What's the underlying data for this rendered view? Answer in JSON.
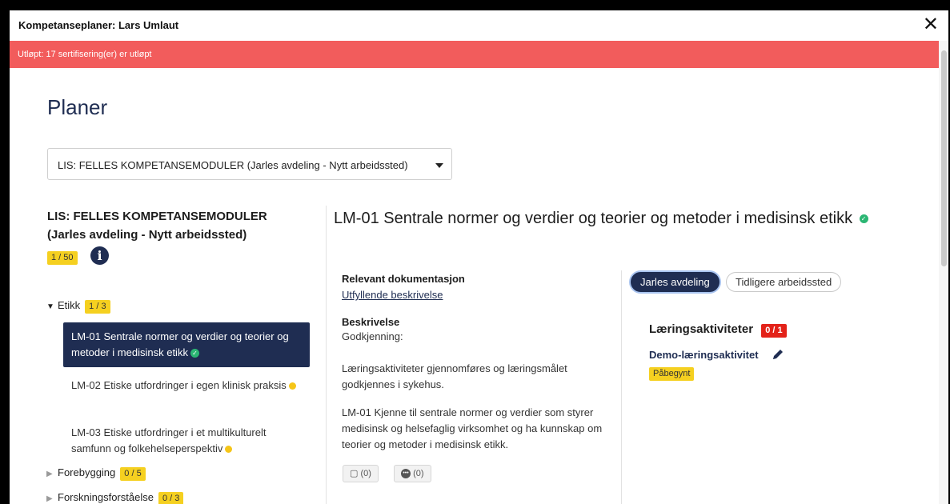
{
  "window": {
    "title": "Kompetanseplaner: Lars Umlaut",
    "close_label": "✕"
  },
  "alert": {
    "text": "Utløpt: 17 sertifisering(er) er utløpt",
    "color": "#f25c5c"
  },
  "page": {
    "heading": "Planer",
    "plan_select": {
      "value": "LIS: FELLES KOMPETANSEMODULER (Jarles avdeling - Nytt arbeidssted)"
    }
  },
  "sidebar": {
    "plan_title": "LIS: FELLES KOMPETANSEMODULER (Jarles avdeling - Nytt arbeidssted)",
    "plan_progress": "1 / 50",
    "info_icon": "i",
    "groups": [
      {
        "name": "Etikk",
        "progress": "1 / 3",
        "expanded": true,
        "items": [
          {
            "label": "LM-01 Sentrale normer og verdier og teorier og metoder i medisinsk etikk",
            "status": "completed",
            "active": true
          },
          {
            "label": "LM-02 Etiske utfordringer i egen klinisk praksis",
            "status": "in-progress",
            "active": false
          },
          {
            "label": "LM-03 Etiske utfordringer i et multikulturelt samfunn og folkehelseperspektiv",
            "status": "in-progress",
            "active": false
          }
        ]
      },
      {
        "name": "Forebygging",
        "progress": "0 / 5",
        "expanded": false
      },
      {
        "name": "Forskningsforståelse",
        "progress": "0 / 3",
        "expanded": false
      }
    ]
  },
  "detail": {
    "title": "LM-01 Sentrale normer og verdier og teorier og metoder i medisinsk etikk",
    "relevant_doc_label": "Relevant dokumentasjon",
    "relevant_doc_link": "Utfyllende beskrivelse",
    "description_label": "Beskrivelse",
    "description_lines": [
      "Godkjenning:",
      "Læringsaktiviteter gjennomføres og læringsmålet godkjennes i sykehus.",
      "LM-01 Kjenne til sentrale normer og verdier som styrer medisinsk og helsefaglig virksomhet og ha kunnskap om teorier og metoder i medisinsk etikk."
    ],
    "attachments_count": "(0)",
    "comments_count": "(0)",
    "tabs": [
      {
        "label": "Jarles avdeling",
        "active": true
      },
      {
        "label": "Tidligere arbeidssted",
        "active": false
      }
    ],
    "learning_activities": {
      "heading": "Læringsaktiviteter",
      "count": "0 / 1",
      "items": [
        {
          "label": "Demo-læringsaktivitet",
          "status": "Påbegynt"
        }
      ]
    }
  },
  "colors": {
    "navy": "#1f2d52",
    "badge_yellow": "#f5d020",
    "badge_red": "#e32219",
    "check_green": "#2bb673",
    "dot_yellow": "#f5c518"
  }
}
